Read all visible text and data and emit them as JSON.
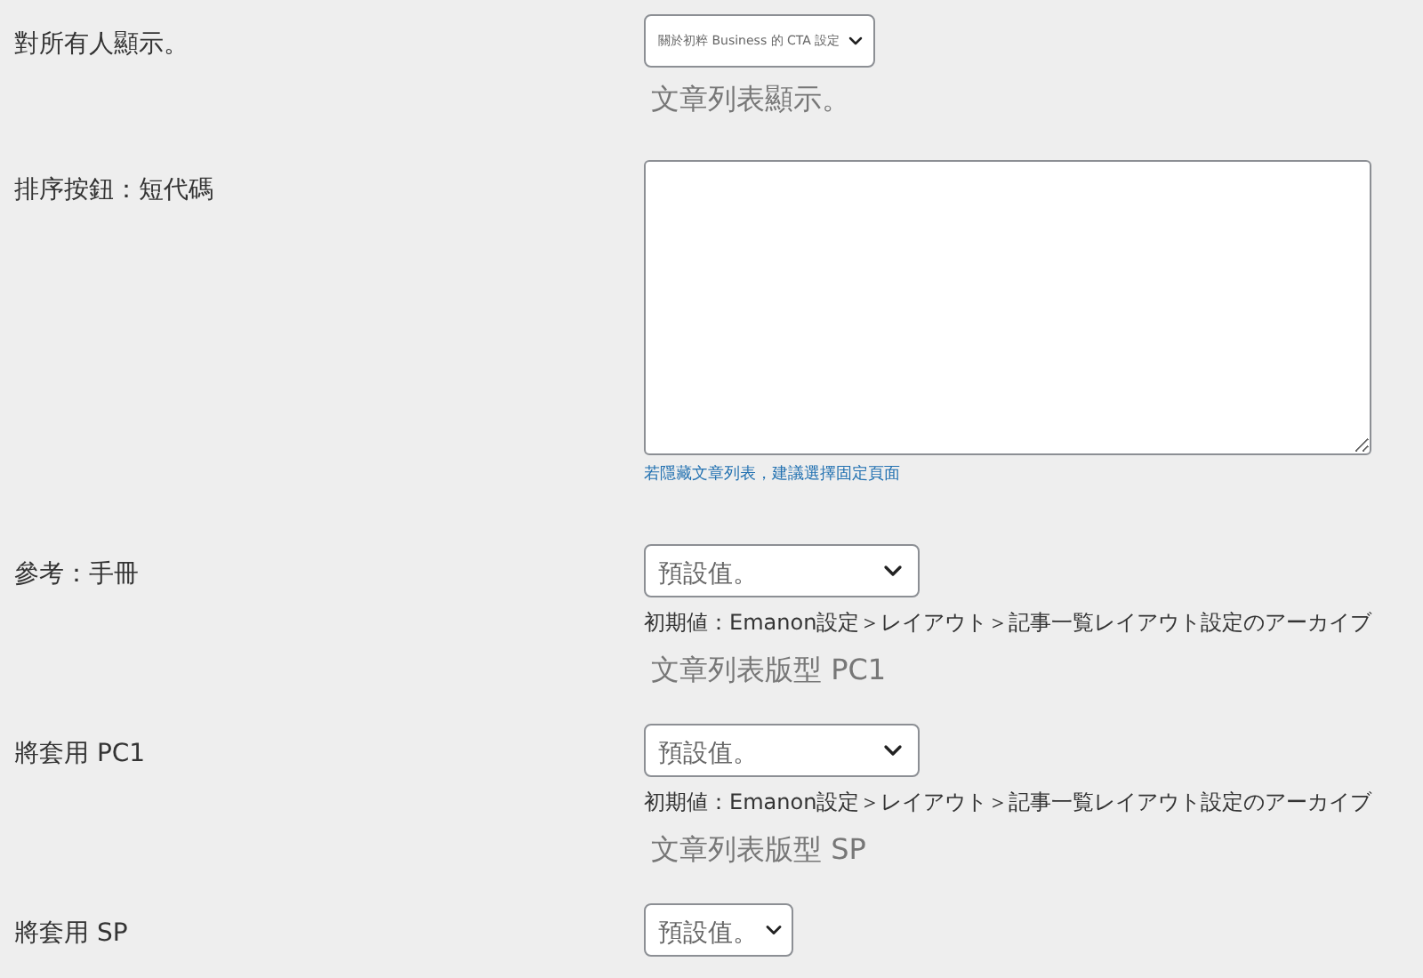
{
  "rows": [
    {
      "label": "對所有人顯示。",
      "control": {
        "kind": "select-small",
        "value": "關於初粹 Business 的 CTA 設定"
      },
      "texts": [
        {
          "kind": "caption",
          "text": "文章列表顯示。"
        }
      ]
    },
    {
      "label": "排序按鈕：短代碼",
      "control": {
        "kind": "textarea"
      },
      "texts": [
        {
          "kind": "hint",
          "text": "若隱藏文章列表，建議選擇固定頁面"
        }
      ]
    },
    {
      "label": "參考：手冊",
      "control": {
        "kind": "select",
        "value": "預設值。"
      },
      "texts": [
        {
          "kind": "note",
          "text": "初期値：Emanon設定＞レイアウト＞記事一覧レイアウト設定のアーカイブ"
        },
        {
          "kind": "caption",
          "text": "文章列表版型 PC1"
        }
      ]
    },
    {
      "label": "將套用 PC1",
      "control": {
        "kind": "select",
        "value": "預設值。"
      },
      "texts": [
        {
          "kind": "note",
          "text": "初期値：Emanon設定＞レイアウト＞記事一覧レイアウト設定のアーカイブ"
        },
        {
          "kind": "caption",
          "text": "文章列表版型 SP"
        }
      ]
    },
    {
      "label": "將套用 SP",
      "control": {
        "kind": "select-narrow",
        "value": "預設值。"
      },
      "texts": []
    }
  ]
}
